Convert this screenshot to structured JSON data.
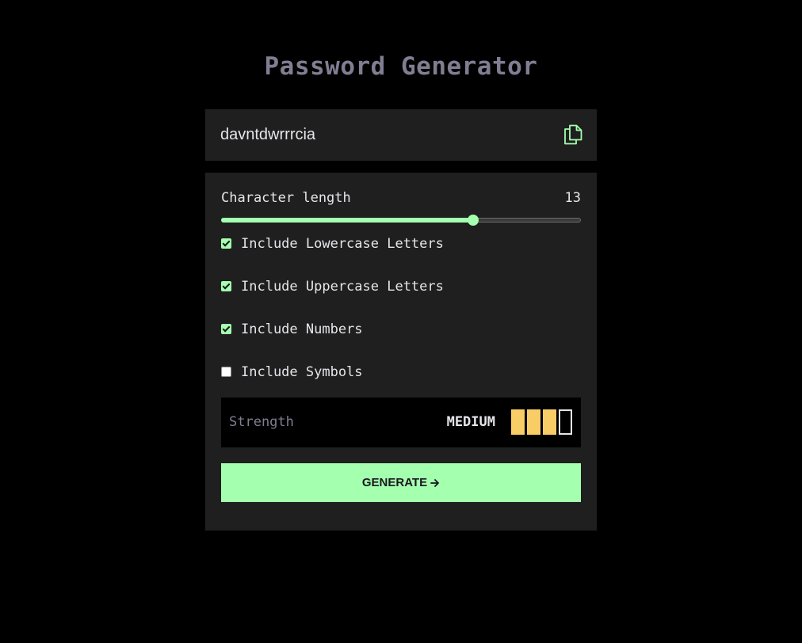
{
  "app": {
    "title": "Password Generator"
  },
  "output": {
    "password": "davntdwrrrcia",
    "copy_icon": "copy-icon"
  },
  "length": {
    "label": "Character length",
    "value": "13",
    "slider_fraction": 0.7
  },
  "options": [
    {
      "label": "Include Lowercase Letters",
      "checked": true
    },
    {
      "label": "Include Uppercase Letters",
      "checked": true
    },
    {
      "label": "Include Numbers",
      "checked": true
    },
    {
      "label": "Include Symbols",
      "checked": false
    }
  ],
  "strength": {
    "label": "Strength",
    "value": "MEDIUM",
    "filled_bars": 3,
    "total_bars": 4
  },
  "generate": {
    "label": "GENERATE",
    "icon": "arrow-right-icon"
  },
  "colors": {
    "accent": "#A4FFAF",
    "strength_medium": "#F8CD65",
    "panel": "#1F1F1F",
    "background": "#000000",
    "title": "#817D92"
  }
}
